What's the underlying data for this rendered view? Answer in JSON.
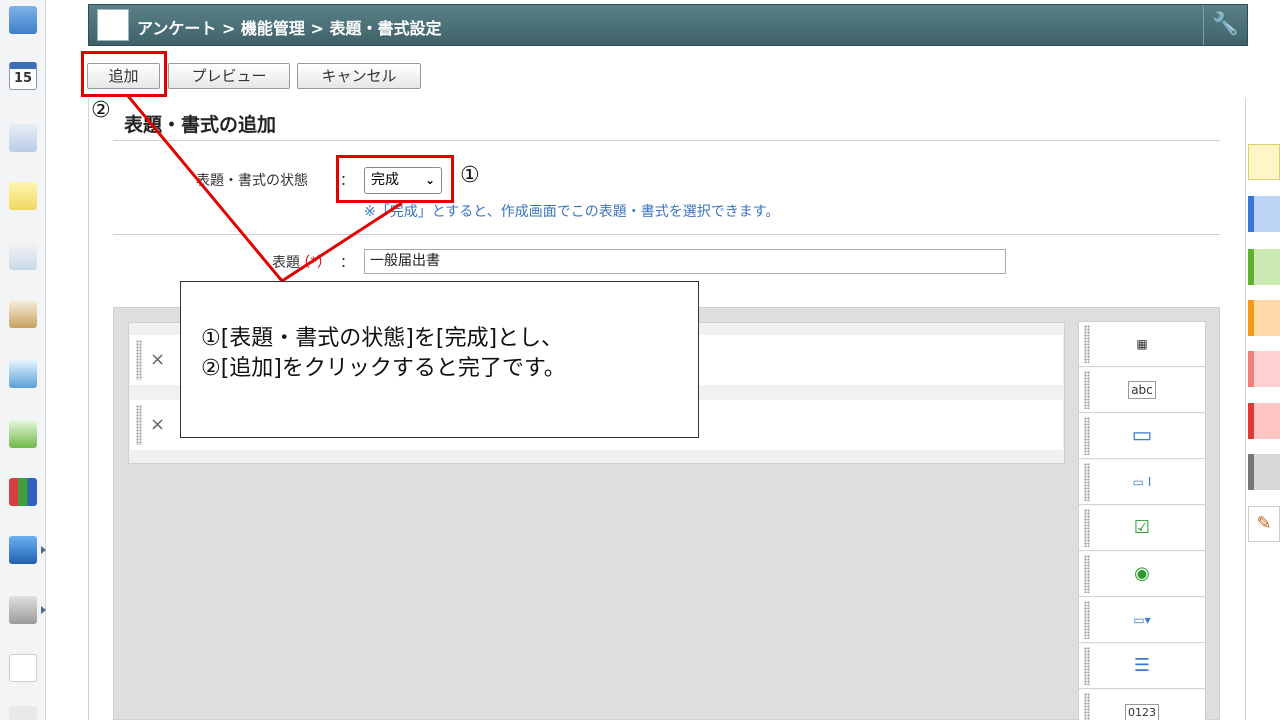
{
  "titlebar": {
    "breadcrumb": "アンケート > 機能管理 > 表題・書式設定",
    "settings_icon": "wrench-icon"
  },
  "toolbar": {
    "add_label": "追加",
    "preview_label": "プレビュー",
    "cancel_label": "キャンセル"
  },
  "section": {
    "heading": "表題・書式の追加"
  },
  "form": {
    "status_label": "表題・書式の状態",
    "status_sep": "：",
    "status_value": "完成",
    "status_hint": "※「完成」とすると、作成画面でこの表題・書式を選択できます。",
    "title_label": "表題",
    "title_required_mark": "（*）",
    "title_sep": "：",
    "title_value": "一般届出書"
  },
  "designer": {
    "rows": [
      {
        "remove_icon": "×"
      },
      {
        "remove_icon": "×"
      }
    ],
    "palette": [
      "▦",
      "abc",
      "▭",
      "▭ I",
      "☑",
      "◉",
      "▭▾",
      "☰",
      "0123"
    ]
  },
  "annotations": {
    "marker1": "①",
    "marker2": "②",
    "callout_line1": "①[表題・書式の状態]を[完成]とし、",
    "callout_line2": "②[追加]をクリックすると完了です。"
  },
  "colors": {
    "titlebar": "#4b6e75",
    "annotation": "#e00000",
    "hint": "#3a74c4"
  }
}
